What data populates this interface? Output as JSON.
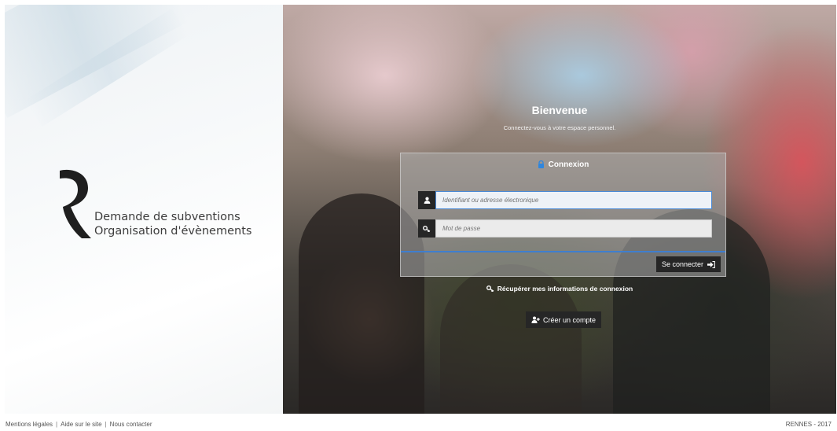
{
  "brand": {
    "line1": "Demande de subventions",
    "line2": "Organisation d'évènements"
  },
  "hero": {
    "title": "Bienvenue",
    "subtitle": "Connectez-vous à votre espace personnel."
  },
  "login": {
    "header": "Connexion",
    "username_placeholder": "Identifiant ou adresse électronique",
    "password_placeholder": "Mot de passe",
    "submit_label": "Se connecter"
  },
  "links": {
    "recover": "Récupérer mes informations de connexion",
    "create_account": "Créer un compte"
  },
  "footer": {
    "links": [
      "Mentions légales",
      "Aide sur le site",
      "Nous contacter"
    ],
    "separator": "|",
    "copyright": "RENNES - 2017"
  },
  "colors": {
    "accent": "#3f7ecf",
    "button_bg": "#262626"
  }
}
